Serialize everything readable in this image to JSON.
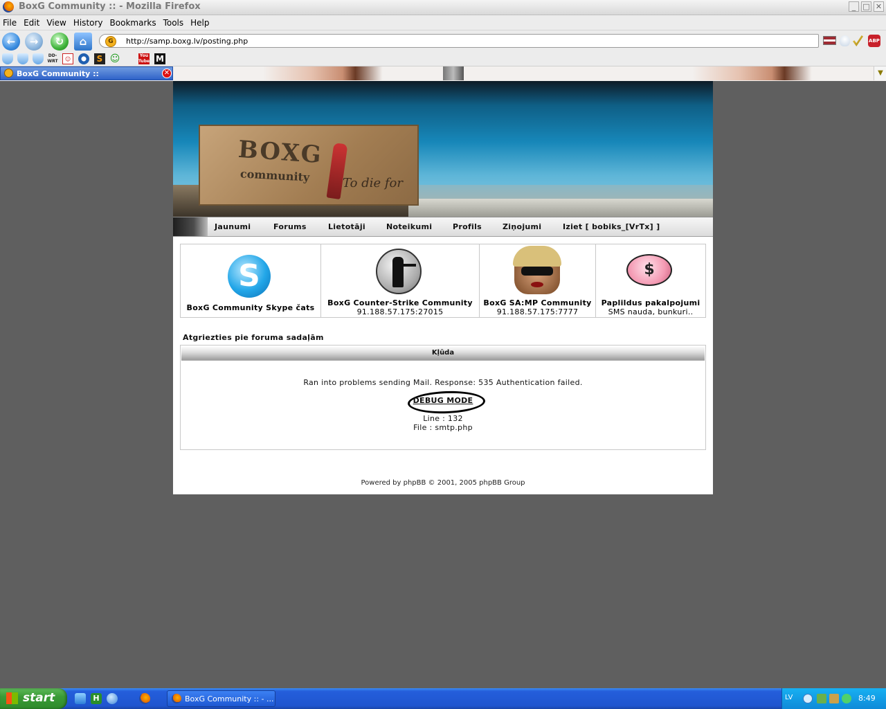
{
  "window": {
    "title": "BoxG Community :: - Mozilla Firefox",
    "controls": {
      "minimize": "_",
      "maximize": "□",
      "close": "✕"
    }
  },
  "menu": [
    "File",
    "Edit",
    "View",
    "History",
    "Bookmarks",
    "Tools",
    "Help"
  ],
  "toolbar": {
    "icons": [
      "back-icon",
      "forward-icon",
      "reload-icon",
      "home-icon"
    ],
    "url": "http://samp.boxg.lv/posting.php",
    "right_icons": [
      "latvian-flag-icon",
      "bulb-icon",
      "tick-icon",
      "adblock-icon"
    ],
    "adblock_label": "ABP"
  },
  "bookmarks": {
    "icons": [
      "shield-icon",
      "shield-icon",
      "shield-icon",
      "dd-wrt-icon",
      "profile-card-icon",
      "globe-icon",
      "s-icon",
      "smile-icon",
      "youtube-icon",
      "m-icon"
    ],
    "ddwrt_label": "DD-WRT",
    "s_label": "S",
    "youtube_label": "You Tube",
    "m_label": "M"
  },
  "tab": {
    "label": "BoxG Community ::",
    "close": "✕"
  },
  "site": {
    "banner": {
      "brand_line1": "BOXG",
      "brand_line2": "community",
      "tagline": "To die for"
    },
    "nav": [
      "Jaunumi",
      "Forums",
      "Lietotāji",
      "Noteikumi",
      "Profils",
      "Ziņojumi",
      "Iziet [ bobiks_[VrTx] ]"
    ],
    "services": [
      {
        "name": "BoxG Community Skype čats",
        "sub": "",
        "icon": "skype-icon"
      },
      {
        "name": "BoxG Counter-Strike Community",
        "sub": "91.188.57.175:27015",
        "icon": "counter-strike-icon"
      },
      {
        "name": "BoxG SA:MP Community",
        "sub": "91.188.57.175:7777",
        "icon": "samp-character-icon"
      },
      {
        "name": "Paplildus pakalpojumi",
        "sub": "SMS nauda, bunkuri..",
        "icon": "piggy-bank-icon"
      }
    ],
    "back_link": "Atgriezties pie foruma sadaļām",
    "error": {
      "heading": "Kļūda",
      "message": "Ran into problems sending Mail. Response: 535 Authentication failed.",
      "debug_label": "DEBUG MODE",
      "line": "Line : 132",
      "file": "File : smtp.php"
    },
    "footer": "Powered by phpBB © 2001, 2005 phpBB Group"
  },
  "taskbar": {
    "start_label": "start",
    "quick_launch": [
      "ie-icon",
      "h-icon",
      "messenger-icon",
      "firefox-icon"
    ],
    "task_label": "BoxG Community :: - ...",
    "language": "LV",
    "clock": "8:49",
    "tray_icons": [
      "arrow-icon",
      "network-icon",
      "speaker-icon",
      "security-icon"
    ]
  }
}
